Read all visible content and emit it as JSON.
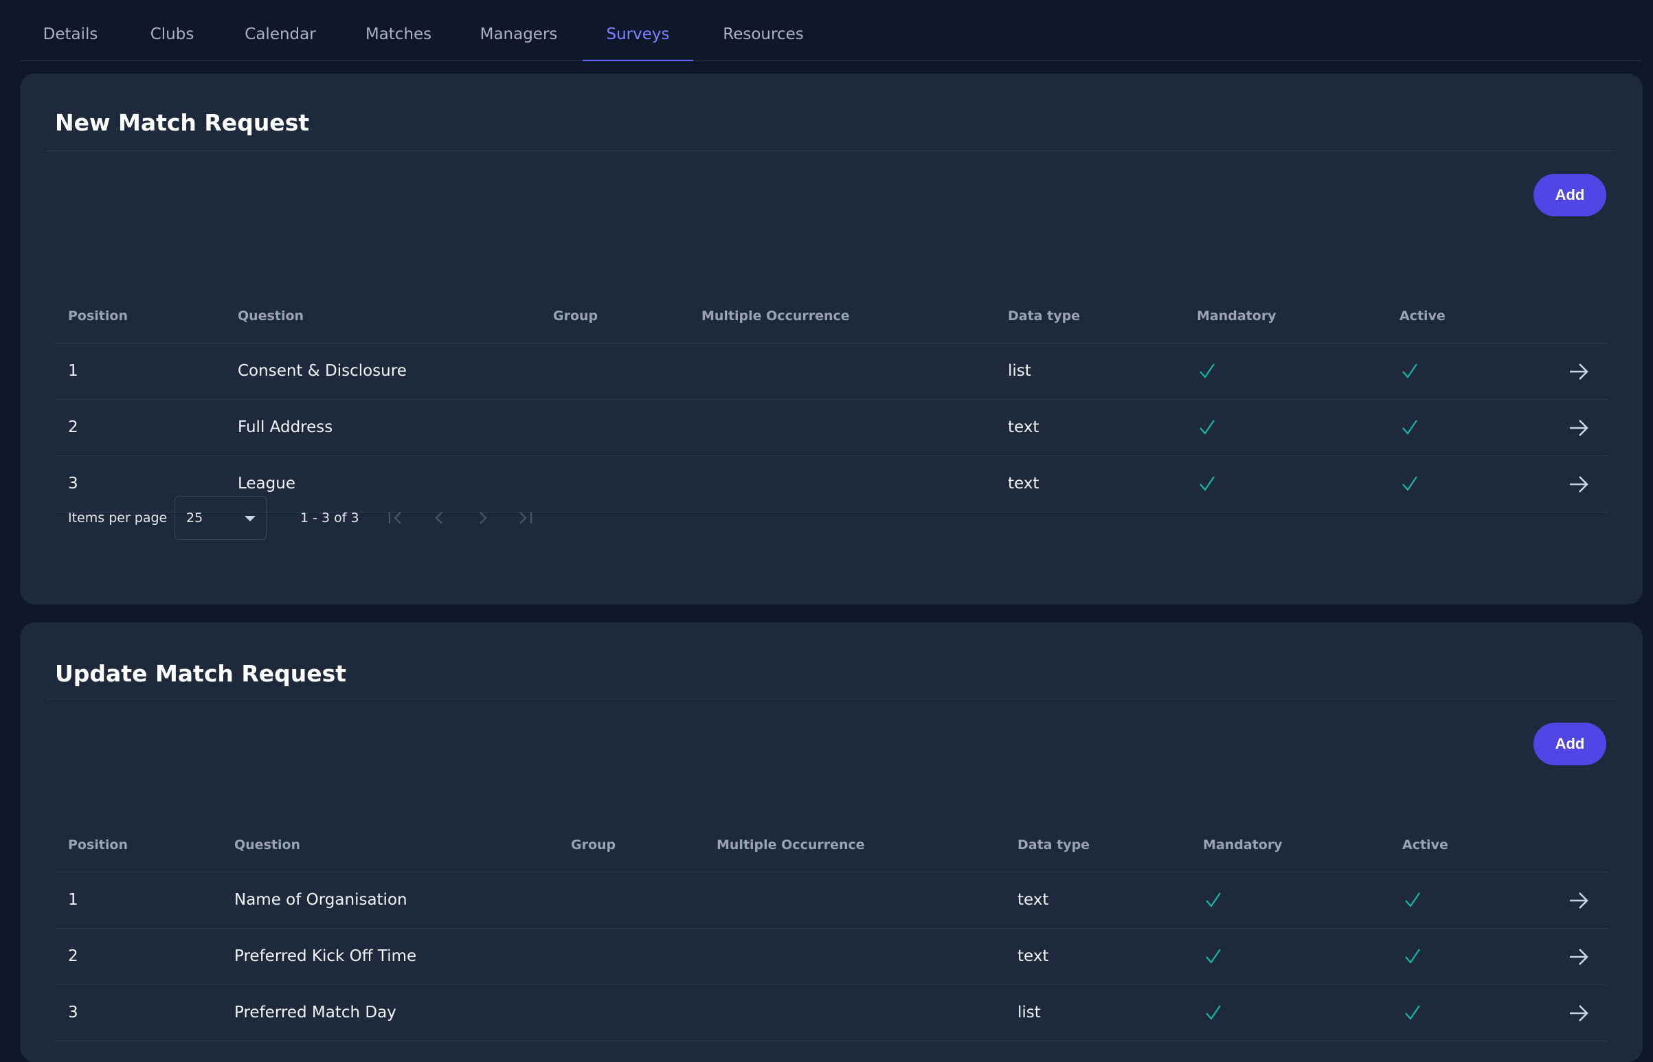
{
  "tabs": [
    {
      "label": "Details"
    },
    {
      "label": "Clubs"
    },
    {
      "label": "Calendar"
    },
    {
      "label": "Matches"
    },
    {
      "label": "Managers"
    },
    {
      "label": "Surveys"
    },
    {
      "label": "Resources"
    }
  ],
  "active_tab": "Surveys",
  "colors": {
    "accent": "#4f46e5",
    "active_tab": "#7c83ff",
    "check": "#14b8a6",
    "card": "#1e293b",
    "background": "#0f172a"
  },
  "icons": {
    "check": "check-icon",
    "row_action": "arrow-right-icon",
    "first_page": "first-page-icon",
    "prev_page": "chevron-left-icon",
    "next_page": "chevron-right-icon",
    "last_page": "last-page-icon"
  },
  "surveys": [
    {
      "title": "New Match Request",
      "add_label": "Add",
      "columns": {
        "position": "Position",
        "question": "Question",
        "group": "Group",
        "multiple": "Multiple Occurrence",
        "datatype": "Data type",
        "mandatory": "Mandatory",
        "active": "Active"
      },
      "rows": [
        {
          "position": "1",
          "question": "Consent & Disclosure",
          "group": "",
          "multiple": "",
          "datatype": "list",
          "mandatory": true,
          "active": true
        },
        {
          "position": "2",
          "question": "Full Address",
          "group": "",
          "multiple": "",
          "datatype": "text",
          "mandatory": true,
          "active": true
        },
        {
          "position": "3",
          "question": "League",
          "group": "",
          "multiple": "",
          "datatype": "text",
          "mandatory": true,
          "active": true
        }
      ],
      "pagination": {
        "items_per_page_label": "Items per page",
        "items_per_page_value": "25",
        "range": "1 - 3 of 3"
      }
    },
    {
      "title": "Update Match Request",
      "add_label": "Add",
      "columns": {
        "position": "Position",
        "question": "Question",
        "group": "Group",
        "multiple": "Multiple Occurrence",
        "datatype": "Data type",
        "mandatory": "Mandatory",
        "active": "Active"
      },
      "rows": [
        {
          "position": "1",
          "question": "Name of Organisation",
          "group": "",
          "multiple": "",
          "datatype": "text",
          "mandatory": true,
          "active": true
        },
        {
          "position": "2",
          "question": "Preferred Kick Off Time",
          "group": "",
          "multiple": "",
          "datatype": "text",
          "mandatory": true,
          "active": true
        },
        {
          "position": "3",
          "question": "Preferred Match Day",
          "group": "",
          "multiple": "",
          "datatype": "list",
          "mandatory": true,
          "active": true
        }
      ]
    }
  ]
}
